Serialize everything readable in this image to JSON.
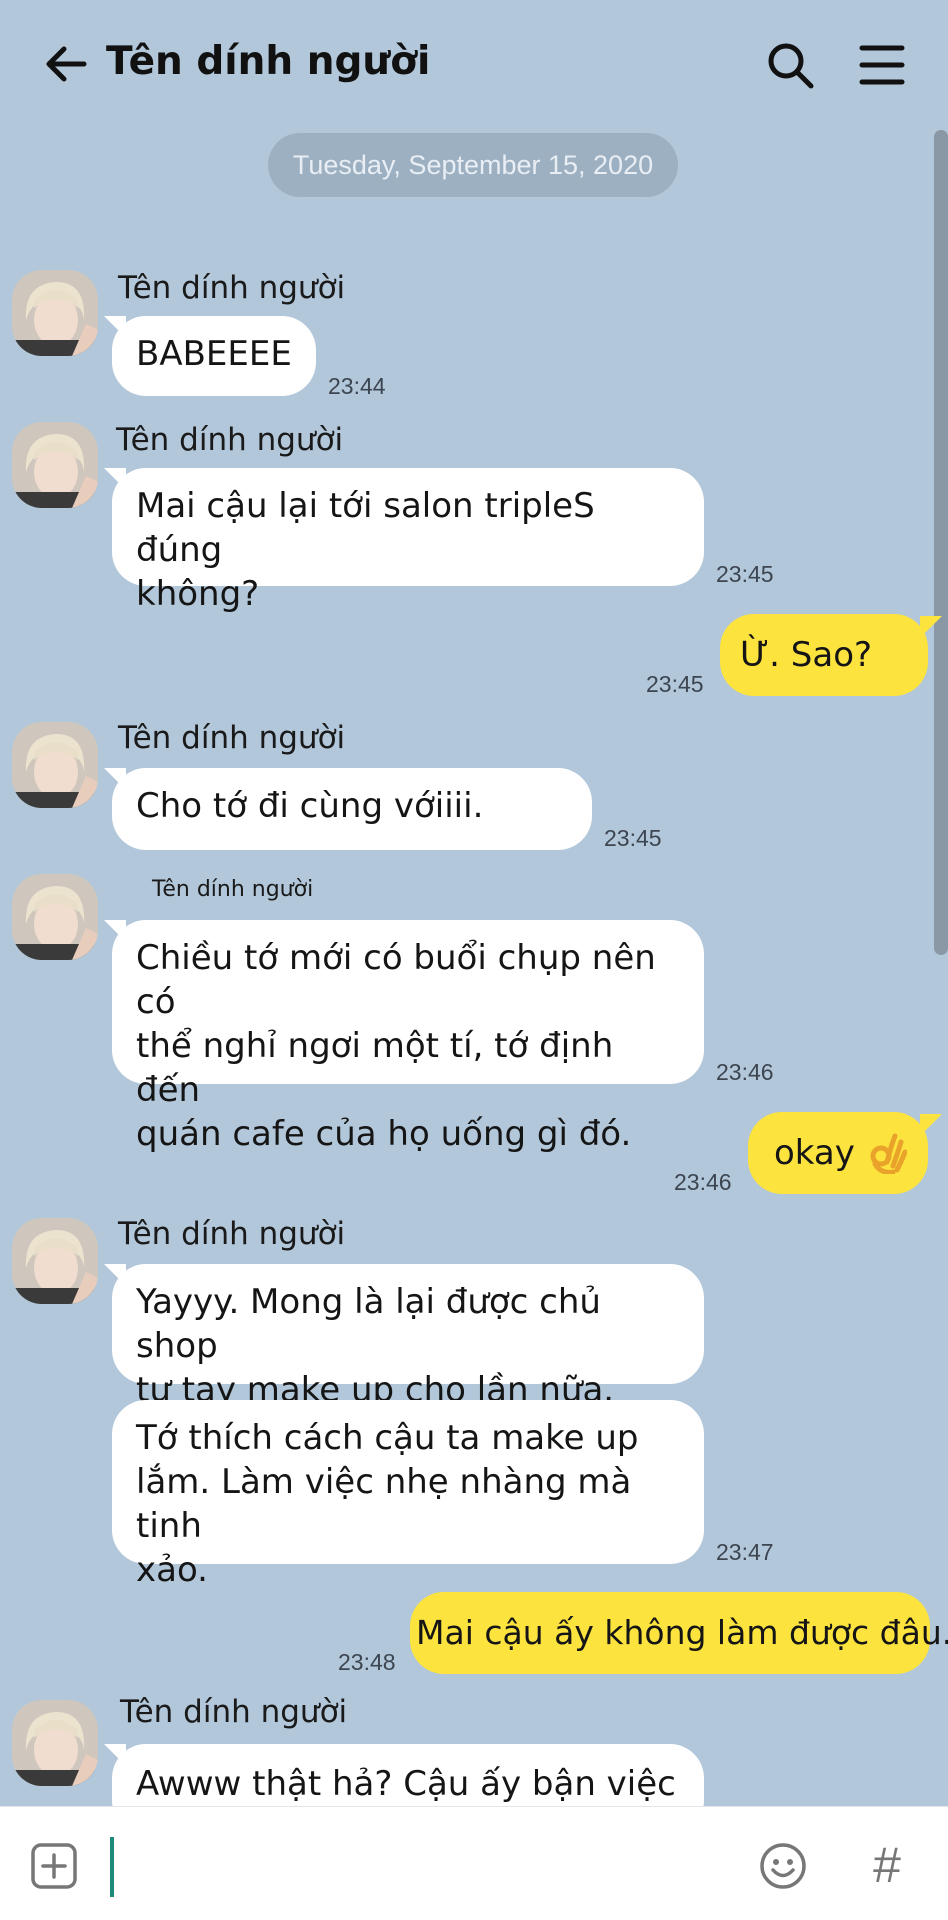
{
  "header": {
    "title": "Tên dính người",
    "icons": {
      "back": "back-arrow-icon",
      "search": "search-icon",
      "menu": "hamburger-menu-icon"
    }
  },
  "date_divider": "Tuesday, September 15, 2020",
  "messages": [
    {
      "sender": "Tên dính người",
      "direction": "in",
      "text": "BABEEEE",
      "time": "23:44"
    },
    {
      "sender": "Tên dính người",
      "direction": "in",
      "text": "Mai cậu lại tới salon tripleS đúng\nkhông?",
      "time": "23:45"
    },
    {
      "direction": "out",
      "text": "Ừ. Sao?",
      "time": "23:45"
    },
    {
      "sender": "Tên dính người",
      "direction": "in",
      "text": "Cho tớ đi cùng vớiiii.",
      "time": "23:45"
    },
    {
      "sender": "Tên dính người",
      "direction": "in",
      "text": "Chiều tớ mới có buổi chụp nên có\nthể nghỉ ngơi một tí, tớ định đến\nquán cafe của họ uống gì đó.",
      "time": "23:46"
    },
    {
      "direction": "out",
      "text": "okay",
      "emoji": "ok-hand-emoji",
      "time": "23:46"
    },
    {
      "sender": "Tên dính người",
      "direction": "in",
      "text": "Yayyy. Mong là lại được chủ shop\ntự tay make up cho lần nữa."
    },
    {
      "direction": "in",
      "text": "Tớ thích cách cậu ta make up\nlắm. Làm việc nhẹ nhàng mà tinh\nxảo.",
      "time": "23:47"
    },
    {
      "direction": "out",
      "text": "Mai cậu ấy không làm được đâu.",
      "time": "23:48"
    },
    {
      "sender": "Tên dính người",
      "direction": "in",
      "text": "Awww thật hả? Cậu ấy bận việc"
    }
  ],
  "input_bar": {
    "icons": {
      "attach": "plus-square-icon",
      "emoji": "smiley-icon",
      "hashtag": "hash-icon"
    },
    "hashtag_glyph": "#",
    "value": ""
  },
  "colors": {
    "background": "#b2c7da",
    "incoming_bubble": "#ffffff",
    "outgoing_bubble": "#fde33e",
    "date_pill": "#9db0c2"
  }
}
